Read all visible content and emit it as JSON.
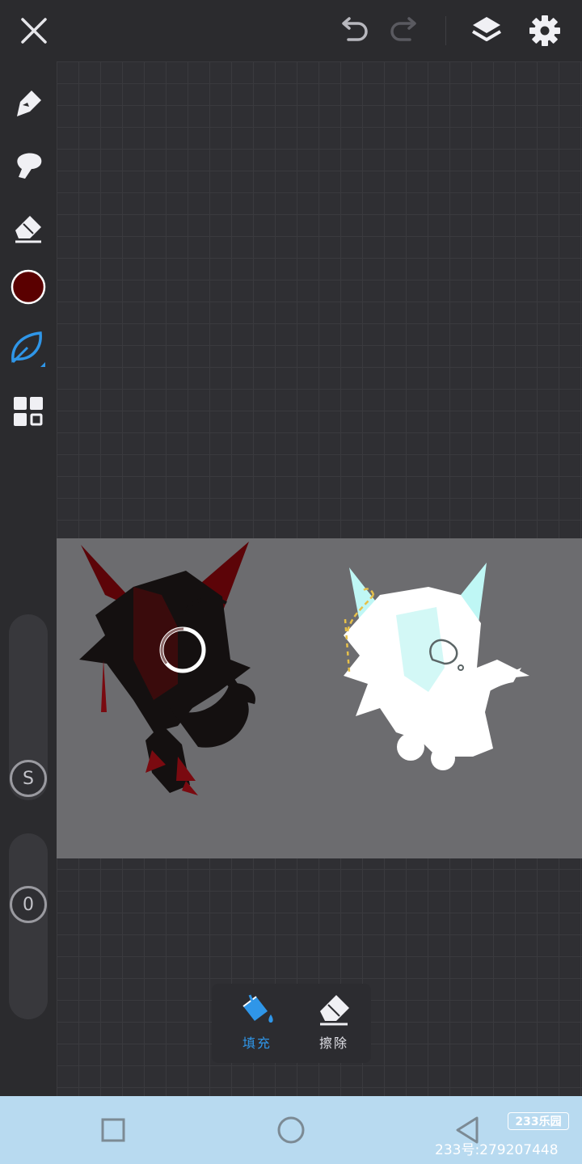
{
  "toolbar": {
    "icons": [
      "close-icon",
      "undo-icon",
      "redo-icon",
      "layers-icon",
      "settings-icon"
    ]
  },
  "sidebar": {
    "tools": [
      "pen-icon",
      "smudge-brush-icon",
      "eraser-icon",
      "color-swatch",
      "leaf-brush-icon",
      "grid-icon"
    ],
    "current_color": "#5a0000",
    "accent_color": "#2f96e8",
    "size_label": "S",
    "opacity_label": "0"
  },
  "fill_popup": {
    "fill_label": "填充",
    "erase_label": "擦除"
  },
  "watermark": {
    "badge": "233乐园",
    "id": "233号:279207448"
  }
}
